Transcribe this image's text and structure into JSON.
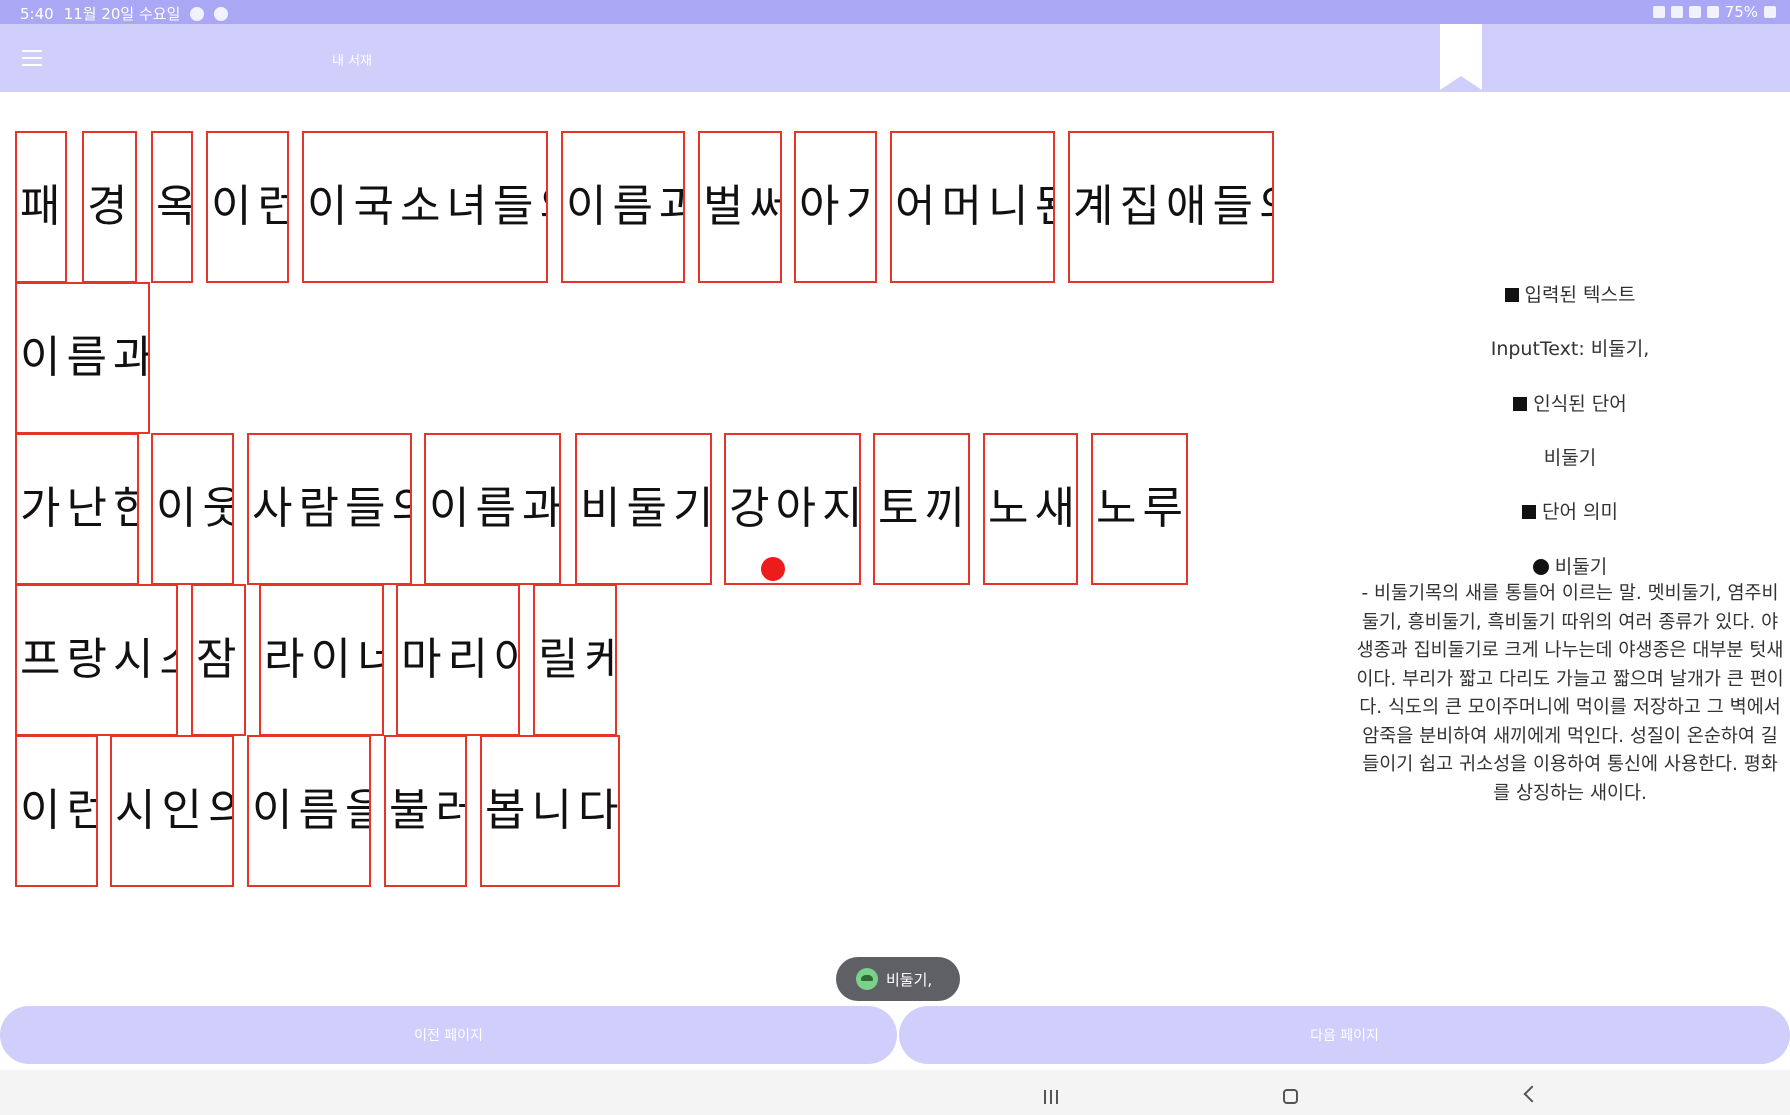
{
  "status_bar": {
    "time": "5:40",
    "date": "11월 20일 수요일",
    "battery": "75%"
  },
  "app_bar": {
    "title": "내 서재"
  },
  "words": [
    "패,",
    "경,",
    "옥",
    "이런",
    "이국소녀들의",
    "이름과",
    "벌써",
    "아기",
    "어머니된",
    "계집애들의",
    "이름과,",
    "가난한",
    "이웃",
    "사람들의",
    "이름과,",
    "비둘기,",
    "강아지,",
    "토끼,",
    "노새,",
    "노루,",
    "프랑시스",
    "잠,",
    "라이너",
    "마리아",
    "릴케",
    "이런",
    "시인의",
    "이름을",
    "불러",
    "봅니다."
  ],
  "side_panel": {
    "input_heading": "입력된 텍스트",
    "input_text": "InputText: 비둘기,",
    "recognized_heading": "인식된 단어",
    "recognized_word": "비둘기",
    "meaning_heading": "단어 의미",
    "meaning_word": "비둘기",
    "meaning_text": "- 비둘기목의 새를 통틀어 이르는 말. 멧비둘기, 염주비둘기, 흥비둘기, 흑비둘기 따위의 여러 종류가 있다. 야생종과 집비둘기로 크게 나누는데 야생종은 대부분 텃새이다. 부리가 짧고 다리도 가늘고 짧으며 날개가 큰 편이다. 식도의 큰 모이주머니에 먹이를 저장하고 그 벽에서 암죽을 분비하여 새끼에게 먹인다. 성질이 온순하여 길들이기 쉽고 귀소성을 이용하여 통신에 사용한다. 평화를 상징하는 새이다."
  },
  "toast": {
    "text": "비둘기,"
  },
  "buttons": {
    "prev": "이전 페이지",
    "next": "다음 페이지"
  },
  "colors": {
    "status_bar": "#aaa7f5",
    "app_bar": "#d0cefb",
    "word_box_border": "#e53528",
    "touch_dot": "#ec1c1c"
  }
}
